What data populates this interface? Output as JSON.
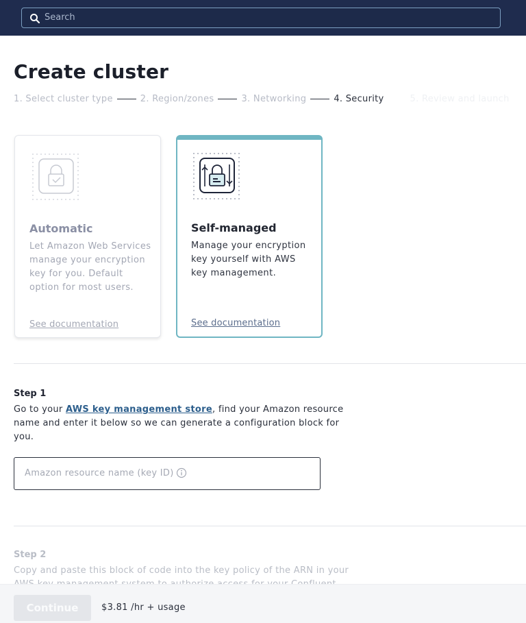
{
  "search": {
    "placeholder": "Search"
  },
  "page": {
    "title": "Create cluster"
  },
  "stepper": {
    "steps": [
      "1. Select cluster type",
      "2. Region/zones",
      "3. Networking",
      "4. Security",
      "5. Review and launch"
    ],
    "active_index": 3
  },
  "cards": [
    {
      "title": "Automatic",
      "description": "Let Amazon Web Services manage your encryption key for you. Default option for most users.",
      "link": "See documentation",
      "selected": false,
      "icon": "lock-check-icon"
    },
    {
      "title": "Self-managed",
      "description": "Manage your encryption key yourself with AWS key management.",
      "link": "See documentation",
      "selected": true,
      "icon": "lock-key-icon"
    }
  ],
  "step1": {
    "heading": "Step 1",
    "text_before": "Go to your ",
    "link": "AWS key management store",
    "text_after": ", find your Amazon resource name and enter it below so we can generate a configuration block for you.",
    "input_placeholder": "Amazon resource name (key ID)",
    "info_icon": "info-icon"
  },
  "step2": {
    "heading": "Step 2",
    "text": "Copy and paste this block of code into the key policy of the ARN in your AWS key management system to authorize access for your Confluent"
  },
  "footer": {
    "continue_label": "Continue",
    "price": "$3.81 /hr + usage"
  },
  "colors": {
    "topbar": "#1f2c4e",
    "accent": "#6fb6c3",
    "link": "#2c5e8c"
  }
}
